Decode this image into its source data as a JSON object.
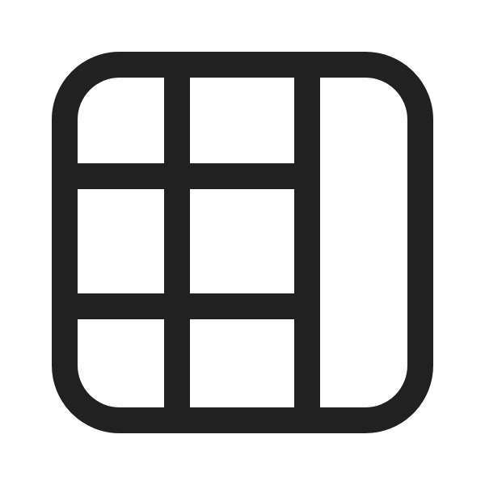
{
  "icon": {
    "name": "table-freeze-column-icon",
    "stroke_color": "#212121",
    "background_color": "#ffffff"
  }
}
